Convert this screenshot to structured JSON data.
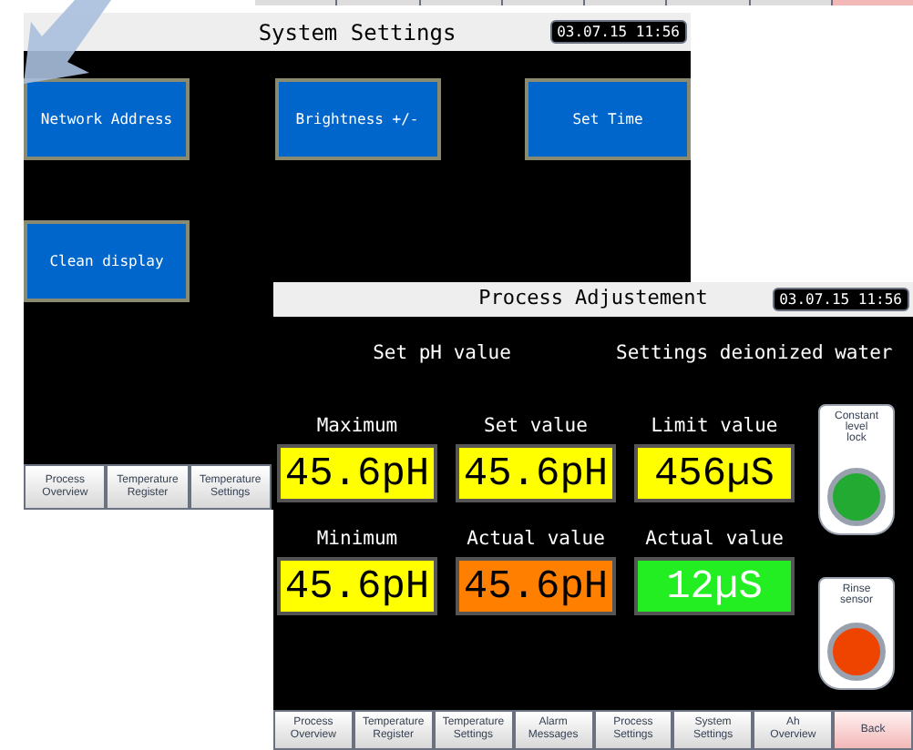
{
  "back_screen": {
    "title": "System Settings",
    "datetime": "03.07.15 11:56",
    "buttons": [
      {
        "label": "Network Address"
      },
      {
        "label": "Brightness +/-"
      },
      {
        "label": "Set Time"
      },
      {
        "label": "Clean display"
      }
    ],
    "tabs": [
      {
        "label": "Process\nOverview"
      },
      {
        "label": "Temperature\nRegister"
      },
      {
        "label": "Temperature\nSettings"
      }
    ]
  },
  "front_screen": {
    "title": "Process Adjustement",
    "datetime": "03.07.15 11:56",
    "sections": [
      "Set pH value",
      "Settings deionized water"
    ],
    "fields": [
      {
        "label": "Maximum",
        "value": "45.6pH",
        "color": "#ffff00"
      },
      {
        "label": "Set value",
        "value": "45.6pH",
        "color": "#ffff00"
      },
      {
        "label": "Limit value",
        "value": "456µS",
        "color": "#ffff00"
      },
      {
        "label": "Minimum",
        "value": "45.6pH",
        "color": "#ffff00"
      },
      {
        "label": "Actual value",
        "value": "45.6pH",
        "color": "#ff8000"
      },
      {
        "label": "Actual value",
        "value": "12µS",
        "color": "#22ee22"
      }
    ],
    "indicators": [
      {
        "label": "Constant\nlevel\nlock",
        "color": "#22aa33"
      },
      {
        "label": "Rinse\nsensor",
        "color": "#ee4400"
      }
    ],
    "tabs": [
      {
        "label": "Process\nOverview",
        "highlighted": false
      },
      {
        "label": "Temperature\nRegister",
        "highlighted": false
      },
      {
        "label": "Temperature\nSettings",
        "highlighted": false
      },
      {
        "label": "Alarm\nMessages",
        "highlighted": false
      },
      {
        "label": "Process\nSettings",
        "highlighted": false
      },
      {
        "label": "System\nSettings",
        "highlighted": false
      },
      {
        "label": "Ah\nOverview",
        "highlighted": false
      },
      {
        "label": "Back",
        "highlighted": true
      }
    ]
  }
}
